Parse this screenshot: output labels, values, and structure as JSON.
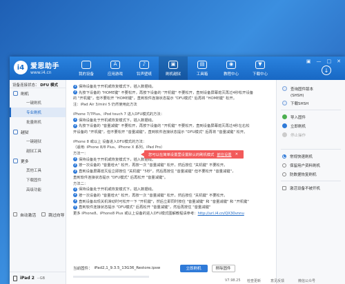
{
  "header": {
    "logo_mark": "i4",
    "logo_title": "爱思助手",
    "logo_url": "www.i4.cn",
    "nav": [
      {
        "label": "我的设备",
        "icon": "apple-icon",
        "glyph": ""
      },
      {
        "label": "应用游戏",
        "icon": "apps-icon",
        "glyph": "A"
      },
      {
        "label": "铃声壁纸",
        "icon": "ringtone-icon",
        "glyph": "♪"
      },
      {
        "label": "刷机越狱",
        "icon": "flash-icon",
        "glyph": "▣"
      },
      {
        "label": "工具箱",
        "icon": "toolbox-icon",
        "glyph": "▤"
      },
      {
        "label": "教程中心",
        "icon": "tutorial-icon",
        "glyph": "◉"
      },
      {
        "label": "下载中心",
        "icon": "download-center-icon",
        "glyph": "▼"
      }
    ],
    "window_controls": [
      "▣",
      "—",
      "□",
      "✕"
    ],
    "download_glyph": "↓"
  },
  "sidebar": {
    "device_status_label": "设备连接状态：",
    "device_status_value": "DFU 模式",
    "groups": [
      {
        "label": "刷机",
        "items": [
          "一键刷机",
          "专业刷机",
          "批量刷机"
        ]
      },
      {
        "label": "越狱",
        "items": [
          "一键越狱",
          "越狱工具"
        ]
      },
      {
        "label": "更多",
        "items": [
          "其他工具",
          "下载固件",
          "高级功能"
        ]
      }
    ],
    "auto_activate": "自动激活",
    "skip_guide": "跳过向导",
    "device_name": "iPad 2",
    "device_storage": "--GB",
    "footer_text": "阻止iTunes自动运行"
  },
  "content": {
    "lines": [
      {
        "num": "1",
        "text": "保持设备处于开机或恢复模式下，插入数据线。"
      },
      {
        "num": "2",
        "text": "先按下设备的 \"HOME键\" 不要松开，再按下设备的 \"开机键\" 不要松开，直到设备屏幕熄灭再过4秒松开设备"
      },
      {
        "num": "",
        "text": "的 \"开机键\"，但不要松开 \"HOME键\"，直到软件连接状态提示 \"DFU模式\" 后再将 \"HOME键\" 松开。"
      },
      {
        "num": "",
        "text": "注：iPad Air 3/mini 5 仍然使用此方法"
      },
      {
        "num": "",
        "text": ""
      },
      {
        "num": "",
        "text": "iPhone 7/7Plus、iPod touch 7 进入DFU模式的方法："
      },
      {
        "num": "1",
        "text": "保持设备处于开机或恢复模式下，插入数据线。"
      },
      {
        "num": "2",
        "text": "先按下设备的 \"音量减键\" 不要松开，再按下设备的 \"开机键\" 不要松开，直到设备屏幕熄灭再过4秒左右松"
      },
      {
        "num": "",
        "text": "开设备的 \"开机键\"，但不要松开 \"音量减键\"，直到软件连接状态提示 \"DFU模式\" 后再将 \"音量减键\" 松开。"
      },
      {
        "num": "",
        "text": ""
      },
      {
        "num": "",
        "text": "iPhone 8 或以上 设备进入DFU模式的方法："
      },
      {
        "num": "",
        "text": "（适用: iPhone 8/8 Plus、iPhone X 系列、iPad Pro）"
      },
      {
        "num": "",
        "text": "方法一："
      },
      {
        "num": "1",
        "text": "保持设备处于开机或恢复模式下，插入数据线。"
      },
      {
        "num": "2",
        "text": "按一次设备的 \"音量增大\" 松开，再按一次 \"音量减键\" 松开，然后按住 \"关机键\" 不要松开。"
      },
      {
        "num": "3",
        "text": "直到设备屏幕熄灭后立即按住 \"关机键\" \"5秒\"，然后再按住 \"音量减键\" 但不要松开 \"音量减键\"，"
      },
      {
        "num": "",
        "text": "直到软件连接状态提示 \"DFU模式\" 后再松开 \"音量减键\"。"
      },
      {
        "num": "",
        "text": "方法二："
      },
      {
        "num": "1",
        "text": "保持设备处于开机或恢复模式下，插入数据线。"
      },
      {
        "num": "2",
        "text": "按一次设备的 \"音量增大\" 松开，再按一次 \"音量减键\" 松开，然后按住 \"关机键\" 不要松开。"
      },
      {
        "num": "3",
        "text": "直到设备出现关机滑动时可松开一下 \"开机键\"，然后立即同时按住 \"音量减键\" 和 \"音量减键\" 和 \"开机键\""
      },
      {
        "num": "4",
        "text": "直到软件连接状态提示 \"DFU模式\" 后再松开 \"音量减键\"，然后再按住 \"音量减键\""
      },
      {
        "num": "",
        "text": "更多 iPhone8、iPhone8 Plus 或以上设备的进入DFU模式图解教程请参考：",
        "link": "http://url.i4.cn/QX30vnnu"
      }
    ]
  },
  "firmware": {
    "label": "当前固件：",
    "file": "iPad2,1_9.3.5_13G36_Restore.ipsw",
    "flash_button": "立即刷机",
    "remove_button": "移除固件"
  },
  "tooltip": {
    "text": "您可以在简单设置里设置默认的刷机模式",
    "link": "前往设置",
    "close": "✕"
  },
  "right_panel": {
    "items": [
      {
        "label": "查询固件版本",
        "sub": "(SHSH)"
      },
      {
        "label": "下载SHSH"
      },
      {
        "label": "导入固件"
      },
      {
        "label": "立即刷机"
      },
      {
        "label": "停止操作"
      }
    ],
    "modes": [
      {
        "label": "常规快速刷机",
        "selected": true
      },
      {
        "label": "保留用户资料刷机",
        "selected": false
      },
      {
        "label": "防数据恢复刷机",
        "selected": false
      }
    ],
    "checkbox_label": "激活设备不被开机",
    "accent": "#2f7ad8",
    "warn": "#f25a5a"
  },
  "statusbar": {
    "version": "V7.98.25",
    "check": "检查更新",
    "feedback": "意见反馈",
    "wechat": "微信公众号"
  }
}
